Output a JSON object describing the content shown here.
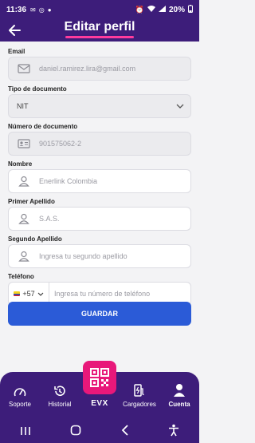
{
  "status_bar": {
    "time": "11:36",
    "battery": "20%"
  },
  "header": {
    "title": "Editar perfil"
  },
  "form": {
    "email": {
      "label": "Email",
      "value": "daniel.ramirez.lira@gmail.com"
    },
    "doc_type": {
      "label": "Tipo de documento",
      "value": "NIT"
    },
    "doc_number": {
      "label": "Número de documento",
      "value": "901575062-2"
    },
    "name": {
      "label": "Nombre",
      "value": "Enerlink Colombia"
    },
    "first_surname": {
      "label": "Primer Apellido",
      "value": "S.A.S."
    },
    "second_surname": {
      "label": "Segundo Apellido",
      "placeholder": "Ingresa tu segundo apellido"
    },
    "phone": {
      "label": "Teléfono",
      "country_code": "+57",
      "placeholder": "Ingresa tu número de teléfono"
    },
    "save_label": "GUARDAR"
  },
  "nav": {
    "items": [
      {
        "label": "Soporte",
        "icon": "gauge-icon"
      },
      {
        "label": "Historial",
        "icon": "history-icon"
      },
      {
        "label": "EVX",
        "icon": "qr-code-icon"
      },
      {
        "label": "Cargadores",
        "icon": "charger-icon"
      },
      {
        "label": "Cuenta",
        "icon": "person-icon",
        "active": true
      }
    ]
  },
  "colors": {
    "primary": "#3d1d7a",
    "accent": "#ff3b9d",
    "button": "#2b5bd7",
    "qr": "#e8187a"
  }
}
